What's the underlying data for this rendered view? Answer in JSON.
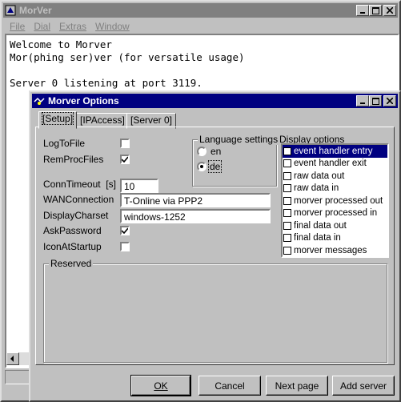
{
  "main_window": {
    "title": "MorVer",
    "menu": [
      "File",
      "Dial",
      "Extras",
      "Window"
    ],
    "console_lines": [
      "Welcome to Morver",
      "Mor(phing ser)ver (for versatile usage)",
      "",
      "Server 0 listening at port 3119."
    ]
  },
  "dialog": {
    "title": "Morver Options",
    "tabs": [
      "[Setup]",
      "[IPAccess]",
      "[Server 0]"
    ],
    "setup": {
      "log_to_file": {
        "label": "LogToFile",
        "checked": false
      },
      "rem_proc_files": {
        "label": "RemProcFiles",
        "checked": true
      },
      "conn_timeout": {
        "label": "ConnTimeout  [s]",
        "value": "10"
      },
      "wan_connection": {
        "label": "WANConnection",
        "value": "T-Online via PPP2"
      },
      "display_charset": {
        "label": "DisplayCharset",
        "value": "windows-1252"
      },
      "ask_password": {
        "label": "AskPassword",
        "checked": true
      },
      "icon_at_startup": {
        "label": "IconAtStartup",
        "checked": false
      }
    },
    "language_settings": {
      "title": "Language settings",
      "options": [
        "en",
        "de"
      ],
      "selected": "de"
    },
    "display_options": {
      "title": "Display options",
      "items": [
        "event handler entry",
        "event handler exit",
        "raw data out",
        "raw data in",
        "morver processed out",
        "morver processed in",
        "final data out",
        "final data in",
        "morver messages"
      ],
      "selected_index": 0
    },
    "reserved_title": "Reserved",
    "buttons": {
      "ok": "OK",
      "cancel": "Cancel",
      "next_page": "Next page",
      "add_server": "Add server"
    }
  }
}
